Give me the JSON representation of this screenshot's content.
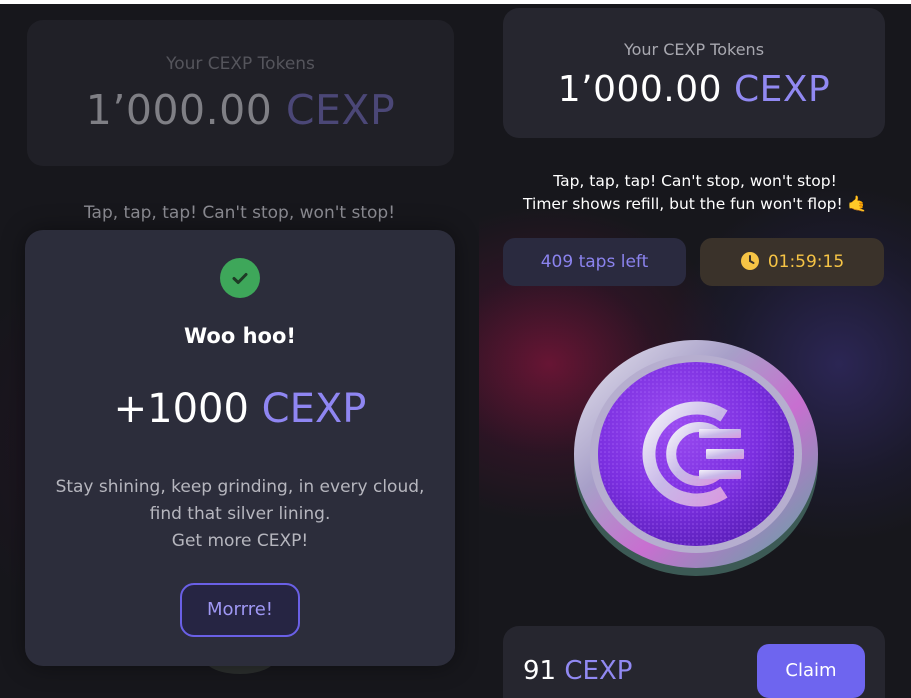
{
  "left_screen": {
    "tokens_card": {
      "label": "Your CEXP Tokens",
      "amount": "1’000.00",
      "currency": "CEXP"
    },
    "tagline": "Tap, tap, tap! Can't stop, won't stop!",
    "modal": {
      "icon": "check-circle-icon",
      "title": "Woo hoo!",
      "reward_amount": "+1000",
      "reward_currency": "CEXP",
      "body_line1": "Stay shining, keep grinding, in every cloud,",
      "body_line2": "find that silver lining.",
      "body_line3": "Get more CEXP!",
      "button_label": "Morrre!"
    }
  },
  "right_screen": {
    "tokens_card": {
      "label": "Your CEXP Tokens",
      "amount": "1’000.00",
      "currency": "CEXP"
    },
    "tagline_line1": "Tap, tap, tap! Can't stop, won't stop!",
    "tagline_line2": "Timer shows refill, but the fun won't flop! 🤙",
    "taps_left": "409 taps left",
    "timer": "01:59:15",
    "coin_icon": "cex-coin-icon",
    "claim": {
      "amount": "91",
      "currency": "CEXP",
      "button_label": "Claim"
    }
  },
  "colors": {
    "accent_purple": "#8f86f2",
    "success_green": "#3ea75a",
    "timer_yellow": "#f6c445",
    "claim_button": "#6e65ef",
    "background": "#17171c"
  }
}
